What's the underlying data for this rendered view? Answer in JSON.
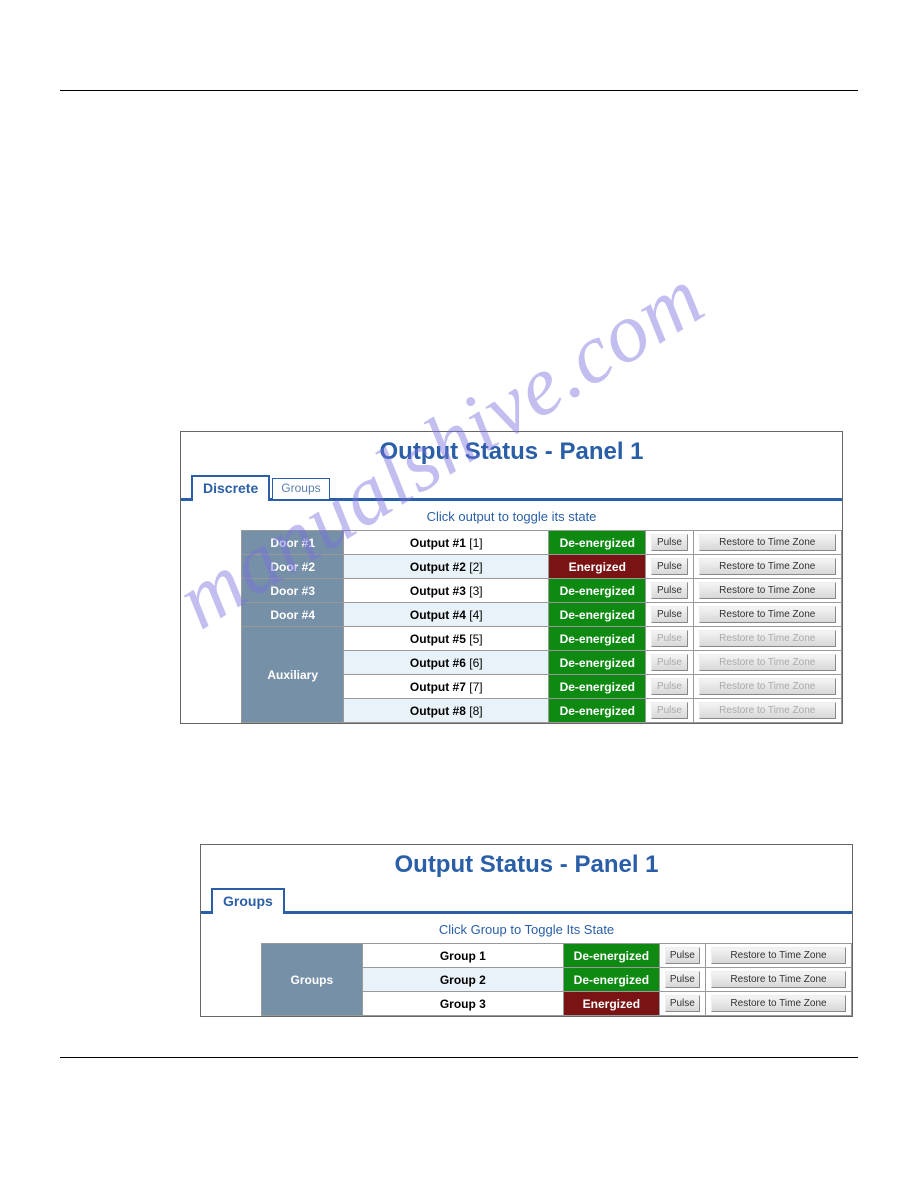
{
  "watermark": "manualshive.com",
  "panel_discrete": {
    "title": "Output Status - Panel 1",
    "tabs": [
      {
        "label": "Discrete",
        "active": true
      },
      {
        "label": "Groups",
        "active": false
      }
    ],
    "hint": "Click output to toggle its state",
    "sections": [
      {
        "header": "Door #1",
        "rows": [
          {
            "name": "Output #1",
            "idx": "[1]",
            "state": "De-energized",
            "state_color": "green",
            "enabled": true,
            "alt": false
          }
        ]
      },
      {
        "header": "Door #2",
        "rows": [
          {
            "name": "Output #2",
            "idx": "[2]",
            "state": "Energized",
            "state_color": "red",
            "enabled": true,
            "alt": true
          }
        ]
      },
      {
        "header": "Door #3",
        "rows": [
          {
            "name": "Output #3",
            "idx": "[3]",
            "state": "De-energized",
            "state_color": "green",
            "enabled": true,
            "alt": false
          }
        ]
      },
      {
        "header": "Door #4",
        "rows": [
          {
            "name": "Output #4",
            "idx": "[4]",
            "state": "De-energized",
            "state_color": "green",
            "enabled": true,
            "alt": true
          }
        ]
      },
      {
        "header": "Auxiliary",
        "rows": [
          {
            "name": "Output #5",
            "idx": "[5]",
            "state": "De-energized",
            "state_color": "green",
            "enabled": false,
            "alt": false
          },
          {
            "name": "Output #6",
            "idx": "[6]",
            "state": "De-energized",
            "state_color": "green",
            "enabled": false,
            "alt": true
          },
          {
            "name": "Output #7",
            "idx": "[7]",
            "state": "De-energized",
            "state_color": "green",
            "enabled": false,
            "alt": false
          },
          {
            "name": "Output #8",
            "idx": "[8]",
            "state": "De-energized",
            "state_color": "green",
            "enabled": false,
            "alt": true
          }
        ]
      }
    ],
    "pulse_label": "Pulse",
    "restore_label": "Restore to Time Zone"
  },
  "panel_groups": {
    "title": "Output Status - Panel 1",
    "tabs": [
      {
        "label": "Groups",
        "active": true
      }
    ],
    "hint": "Click Group to Toggle Its State",
    "header": "Groups",
    "rows": [
      {
        "name": "Group 1",
        "state": "De-energized",
        "state_color": "green",
        "alt": false
      },
      {
        "name": "Group 2",
        "state": "De-energized",
        "state_color": "green",
        "alt": true
      },
      {
        "name": "Group 3",
        "state": "Energized",
        "state_color": "red",
        "alt": false
      }
    ],
    "pulse_label": "Pulse",
    "restore_label": "Restore to Time Zone"
  }
}
